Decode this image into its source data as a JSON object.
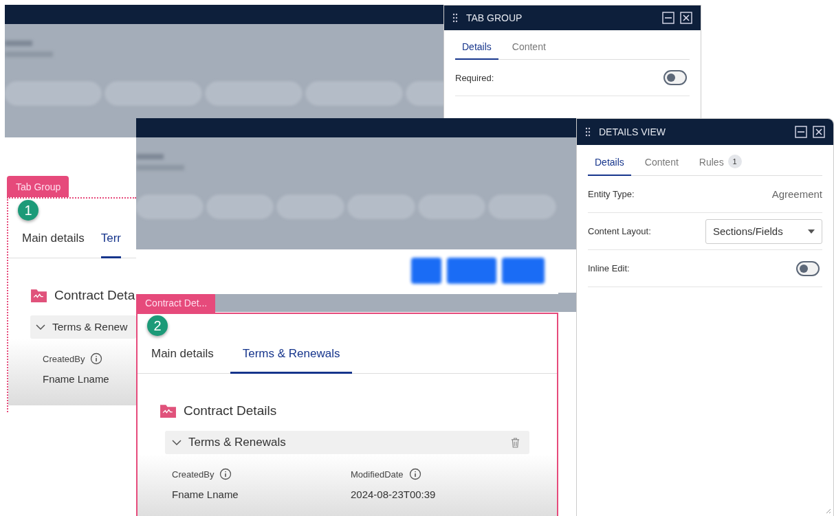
{
  "screens": [
    {
      "tag": "Tab Group",
      "badge": "1",
      "tabs": [
        {
          "label": "Main details",
          "selected": false
        },
        {
          "label": "Terr",
          "selected": true
        }
      ],
      "section_title": "Contract Deta",
      "group": {
        "title": "Terms & Renew",
        "expanded": true
      },
      "fields": [
        {
          "label": "CreatedBy",
          "value": "Fname Lname"
        }
      ]
    },
    {
      "tag": "Contract Det...",
      "badge": "2",
      "tabs": [
        {
          "label": "Main details",
          "selected": false
        },
        {
          "label": "Terms & Renewals",
          "selected": true
        }
      ],
      "section_title": "Contract Details",
      "group": {
        "title": "Terms & Renewals",
        "expanded": true
      },
      "fields": [
        {
          "label": "CreatedBy",
          "value": "Fname Lname"
        },
        {
          "label": "ModifiedDate",
          "value": "2024-08-23T00:39"
        }
      ]
    }
  ],
  "panels": [
    {
      "title": "TAB GROUP",
      "tabs": [
        {
          "label": "Details",
          "selected": true
        },
        {
          "label": "Content",
          "selected": false
        }
      ],
      "properties": [
        {
          "kind": "toggle",
          "label": "Required:",
          "on": false
        }
      ]
    },
    {
      "title": "DETAILS VIEW",
      "tabs": [
        {
          "label": "Details",
          "selected": true
        },
        {
          "label": "Content",
          "selected": false
        },
        {
          "label": "Rules",
          "selected": false,
          "count": "1"
        }
      ],
      "properties": [
        {
          "kind": "text",
          "label": "Entity Type:",
          "value": "Agreement"
        },
        {
          "kind": "select",
          "label": "Content Layout:",
          "value": "Sections/Fields"
        },
        {
          "kind": "toggle",
          "label": "Inline Edit:",
          "on": false
        }
      ]
    }
  ]
}
